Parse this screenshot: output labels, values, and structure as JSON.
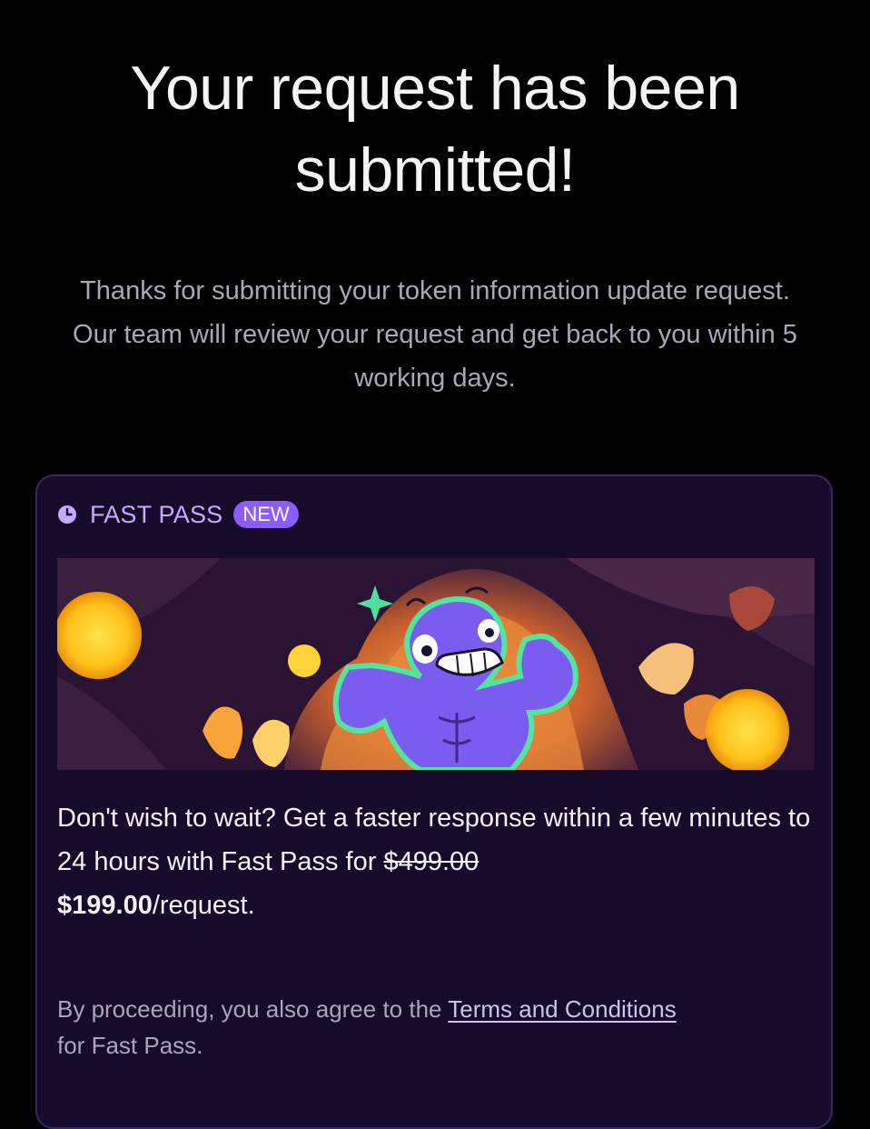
{
  "header": {
    "title": "Your request has been submitted!"
  },
  "main": {
    "message": "Thanks for submitting your token information update request. Our team will review your request and get back to you within 5 working days."
  },
  "fast_pass": {
    "label": "FAST PASS",
    "badge": "NEW",
    "offer_prefix": "Don't wish to wait? Get a faster response within a few minutes to 24 hours with Fast Pass for ",
    "old_price": "$499.00",
    "new_price": "$199.00",
    "price_unit": "/request.",
    "agree_prefix": "By proceeding, you also agree to the ",
    "terms_link": "Terms and Conditions",
    "agree_suffix": " for Fast Pass."
  },
  "colors": {
    "background": "#000000",
    "card_background": "#170b2c",
    "card_border": "#3a2566",
    "accent": "#c7a9ff",
    "badge": "#8b5cf6"
  },
  "icons": {
    "fast_pass": "clock-icon",
    "banner": "muscular-mascot-illustration"
  }
}
